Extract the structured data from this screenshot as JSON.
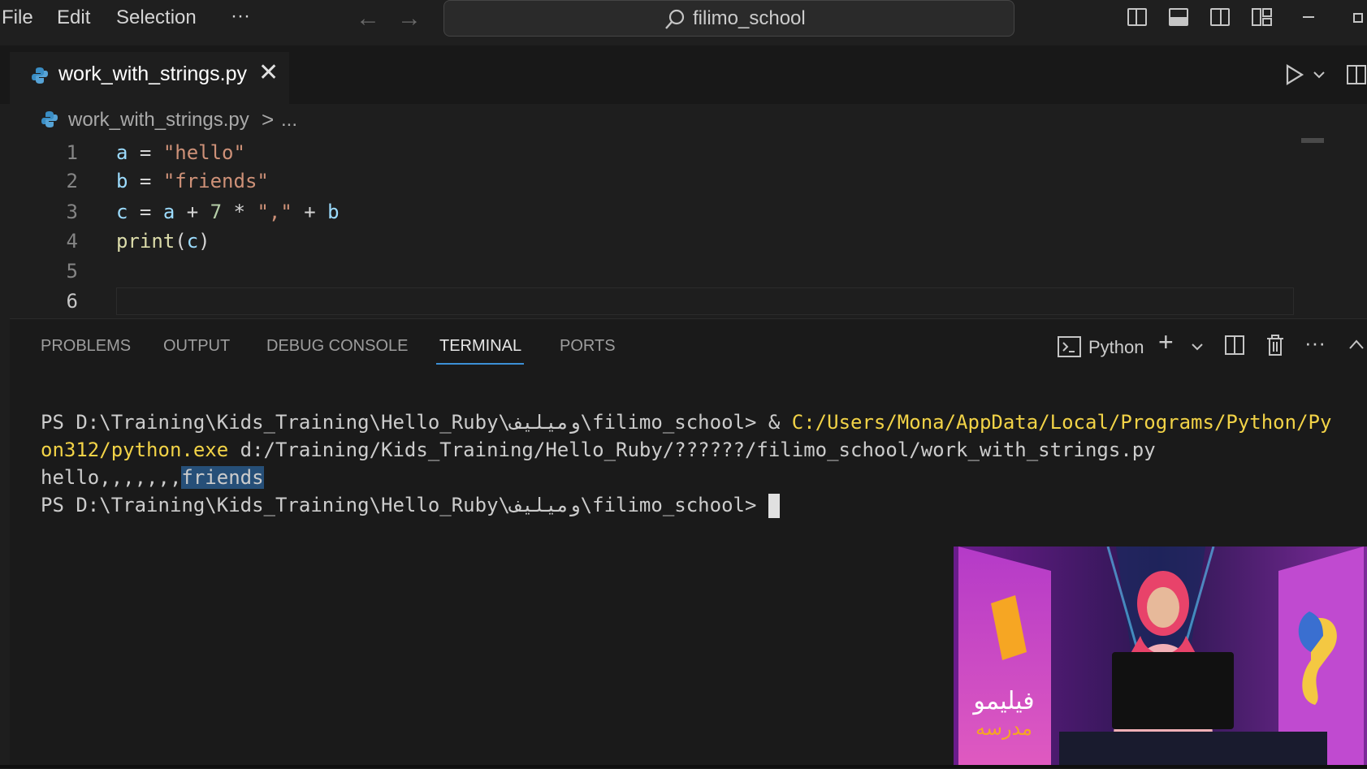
{
  "menu": {
    "file": "File",
    "edit": "Edit",
    "selection": "Selection",
    "more": "···"
  },
  "search": {
    "text": "filimo_school"
  },
  "tab": {
    "title": "work_with_strings.py",
    "close": "✕"
  },
  "breadcrumb": {
    "file": "work_with_strings.py",
    "sep": ">",
    "more": "..."
  },
  "code": {
    "line_numbers": [
      "1",
      "2",
      "3",
      "4",
      "5",
      "6"
    ],
    "lines": [
      [
        {
          "t": "a",
          "c": "var"
        },
        {
          "t": " = ",
          "c": "op"
        },
        {
          "t": "\"hello\"",
          "c": "str"
        }
      ],
      [
        {
          "t": "b",
          "c": "var"
        },
        {
          "t": " = ",
          "c": "op"
        },
        {
          "t": "\"friends\"",
          "c": "str"
        }
      ],
      [
        {
          "t": "c",
          "c": "var"
        },
        {
          "t": " = ",
          "c": "op"
        },
        {
          "t": "a",
          "c": "var"
        },
        {
          "t": " + ",
          "c": "op"
        },
        {
          "t": "7",
          "c": "num"
        },
        {
          "t": " * ",
          "c": "op"
        },
        {
          "t": "\",\"",
          "c": "str"
        },
        {
          "t": " + ",
          "c": "op"
        },
        {
          "t": "b",
          "c": "var"
        }
      ],
      [
        {
          "t": "print",
          "c": "fn"
        },
        {
          "t": "(",
          "c": "op"
        },
        {
          "t": "c",
          "c": "var"
        },
        {
          "t": ")",
          "c": "op"
        }
      ],
      [],
      []
    ]
  },
  "panel": {
    "tabs": [
      "PROBLEMS",
      "OUTPUT",
      "DEBUG CONSOLE",
      "TERMINAL",
      "PORTS"
    ],
    "active_tab": "TERMINAL",
    "shell": "Python",
    "more": "···"
  },
  "terminal": {
    "l1_prompt": "PS D:\\Training\\Kids_Training\\Hello_Ruby\\ومیلیف\\filimo_school> & ",
    "l1_cmd": "C:/Users/Mona/AppData/Local/Programs/Python/Py",
    "l2_cmd": "on312/python.exe",
    "l2_arg": " d:/Training/Kids_Training/Hello_Ruby/??????/filimo_school/work_with_strings.py",
    "l3_out": "hello,,,,,,,",
    "l3_sel": "friends",
    "l4_prompt": "PS D:\\Training\\Kids_Training\\Hello_Ruby\\ومیلیف\\filimo_school> "
  },
  "webcam": {
    "logo_line1": "فیلیمو",
    "logo_line2": "مدرسه"
  },
  "colors": {
    "accent": "#3c8fd6",
    "selection": "#264f78",
    "yellow": "#f2d347"
  }
}
